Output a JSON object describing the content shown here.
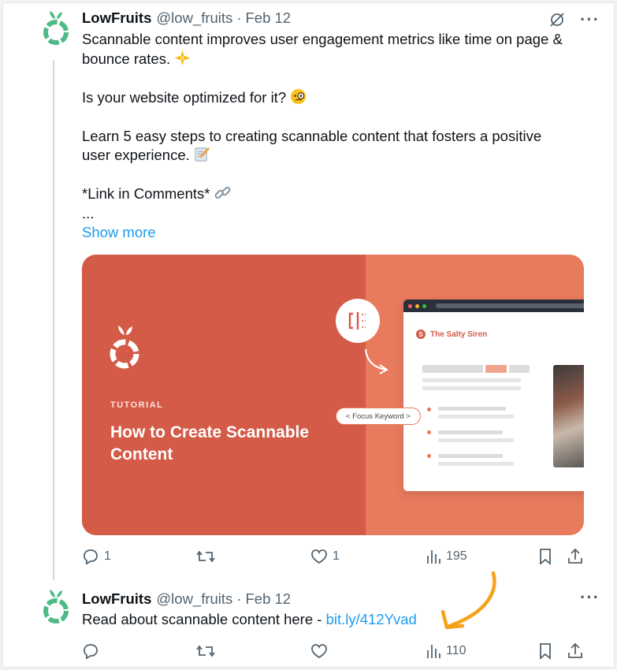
{
  "tweet1": {
    "name": "LowFruits",
    "handle": "@low_fruits",
    "separator": "·",
    "date": "Feb 12",
    "lines": [
      "Scannable content improves user engagement metrics like time on page &",
      "bounce rates.",
      "",
      "Is your website optimized for it?",
      "",
      "Learn 5 easy steps to creating scannable content that fosters a positive",
      "user experience.",
      "",
      "*Link in Comments*",
      "..."
    ],
    "show_more": "Show more",
    "media": {
      "kicker": "TUTORIAL",
      "title": "How to Create Scannable Content",
      "site_initial": "S",
      "site_name": "The Salty Siren",
      "keyword_pill": "< Focus Keyword >"
    },
    "actions": {
      "replies": "1",
      "reposts": "",
      "likes": "1",
      "views": "195"
    }
  },
  "tweet2": {
    "name": "LowFruits",
    "handle": "@low_fruits",
    "separator": "·",
    "date": "Feb 12",
    "text": "Read about scannable content here - ",
    "link": "bit.ly/412Yvad",
    "actions": {
      "replies": "",
      "reposts": "",
      "likes": "",
      "views": "110"
    }
  },
  "icons": [
    "lowfruits-logo-icon",
    "grok-icon",
    "more-icon",
    "sparkle-emoji-icon",
    "monocle-emoji-icon",
    "memo-emoji-icon",
    "link-emoji-icon",
    "reply-icon",
    "repost-icon",
    "like-icon",
    "views-icon",
    "bookmark-icon",
    "share-icon",
    "orange-arrow-icon"
  ],
  "colors": {
    "accent": "#1d9bf0",
    "brand_red": "#d45b48",
    "brand_coral": "#e87a5d",
    "logo_green": "#4dba87",
    "arrow_orange": "#f7a21b"
  }
}
